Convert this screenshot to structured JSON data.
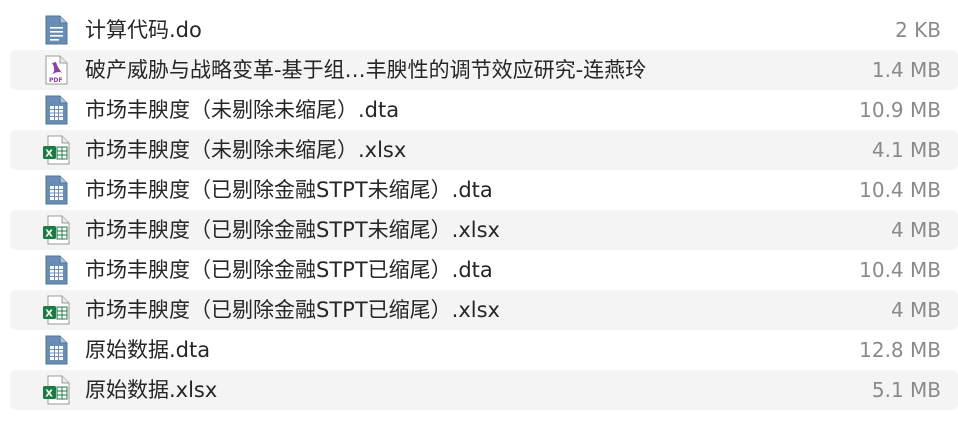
{
  "files": [
    {
      "name": "计算代码.do",
      "size": "2 KB",
      "icon": "text-doc-icon"
    },
    {
      "name": "破产威胁与战略变革-基于组…丰腴性的调节效应研究-连燕玲",
      "size": "1.4 MB",
      "icon": "pdf-icon"
    },
    {
      "name": "市场丰腴度（未剔除未缩尾）.dta",
      "size": "10.9 MB",
      "icon": "dta-doc-icon"
    },
    {
      "name": "市场丰腴度（未剔除未缩尾）.xlsx",
      "size": "4.1 MB",
      "icon": "excel-icon"
    },
    {
      "name": "市场丰腴度（已剔除金融STPT未缩尾）.dta",
      "size": "10.4 MB",
      "icon": "dta-doc-icon"
    },
    {
      "name": "市场丰腴度（已剔除金融STPT未缩尾）.xlsx",
      "size": "4 MB",
      "icon": "excel-icon"
    },
    {
      "name": "市场丰腴度（已剔除金融STPT已缩尾）.dta",
      "size": "10.4 MB",
      "icon": "dta-doc-icon"
    },
    {
      "name": "市场丰腴度（已剔除金融STPT已缩尾）.xlsx",
      "size": "4 MB",
      "icon": "excel-icon"
    },
    {
      "name": "原始数据.dta",
      "size": "12.8 MB",
      "icon": "dta-doc-icon"
    },
    {
      "name": "原始数据.xlsx",
      "size": "5.1 MB",
      "icon": "excel-icon"
    }
  ],
  "colors": {
    "stripe": "#f4f4f5",
    "doc_icon": "#5b7ea3",
    "pdf_icon": "#7a3f9a",
    "excel_green": "#1e7b45"
  }
}
